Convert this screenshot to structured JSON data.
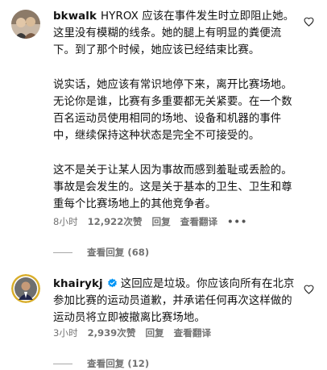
{
  "comments": [
    {
      "username": "bkwalk",
      "paragraphs": [
        "HYROX 应该在事件发生时立即阻止她。这里没有模糊的线条。她的腿上有明显的粪便流下。到了那个时候，她应该已经结束比赛。",
        "说实话，她应该有常识地停下来，离开比赛场地。无论你是谁，比赛有多重要都无关紧要。在一个数百名运动员使用相同的场地、设备和机器的事件中，继续保持这种状态是完全不可接受的。",
        "这不是关于让某人因为事故而感到羞耻或丢脸的。事故是会发生的。这是关于基本的卫生、卫生和尊重每个比赛场地上的其他竞争者。"
      ],
      "time": "8小时",
      "likes": "12,922次赞",
      "reply_label": "回复",
      "see_translation": "查看翻译",
      "more_icon": "more-horizontal-icon",
      "view_replies": "查看回复 (68)"
    },
    {
      "username": "khairykj",
      "verified": true,
      "paragraphs": [
        "这回应是垃圾。你应该向所有在北京参加比赛的运动员道歉，并承诺任何再次这样做的运动员将立即被撤离比赛场地。"
      ],
      "time": "3小时",
      "likes": "2,939次赞",
      "reply_label": "回复",
      "see_translation": "查看翻译",
      "view_replies": "查看回复 (12)"
    }
  ],
  "colors": {
    "text": "#111111",
    "meta": "#737373",
    "verified_blue": "#0095f6"
  }
}
